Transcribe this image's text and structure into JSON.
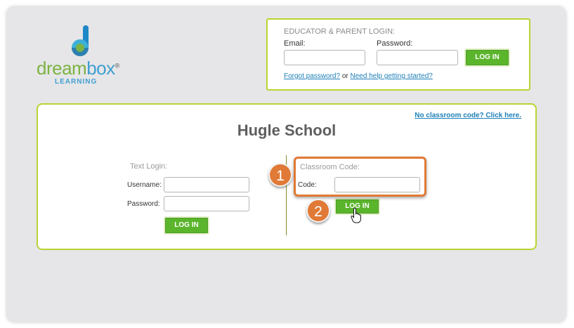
{
  "logo": {
    "word_dream": "dream",
    "word_box": "box",
    "trademark": "®",
    "subtitle": "LEARNING"
  },
  "educator": {
    "title": "EDUCATOR & PARENT LOGIN:",
    "email_label": "Email:",
    "email_value": "",
    "password_label": "Password:",
    "password_value": "",
    "login_button": "LOG IN",
    "forgot_link": "Forgot password?",
    "or_text": "or",
    "help_link": "Need help getting started?"
  },
  "school": {
    "no_code_link": "No classroom code? Click here.",
    "name": "Hugle School",
    "text_login": {
      "title": "Text Login:",
      "username_label": "Username:",
      "username_value": "",
      "password_label": "Password:",
      "password_value": "",
      "login_button": "LOG IN"
    },
    "classroom_code": {
      "title": "Classroom Code:",
      "code_label": "Code:",
      "code_value": "",
      "login_button": "LOG IN"
    }
  },
  "annotations": {
    "step1": "1",
    "step2": "2"
  },
  "colors": {
    "accent_green": "#5bb52c",
    "border_lime": "#b8d432",
    "callout_orange": "#e07a36",
    "link_blue": "#1d7fb8"
  }
}
